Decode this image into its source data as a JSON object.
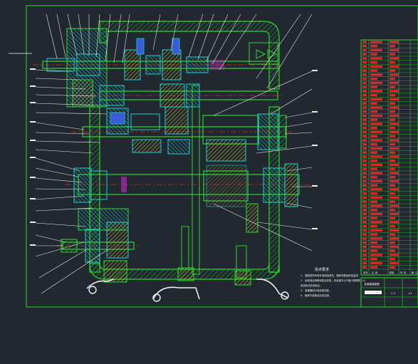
{
  "drawing": {
    "background": "#212830",
    "frame_color": "#2fd62f",
    "tech_notes": {
      "title": "技术要求",
      "lines": [
        "1. 装配前所有零件用煤油清洗，箱体内壁涂耐油油漆。",
        "2. 齿轮啮合侧隙用铅丝检验，其余量不小于最小侧隙的1/4，",
        "   用涂色法检验斑点。",
        "3. 减速器剖分面涂密封胶。",
        "4. 箱体外表面涂灰色油漆。"
      ]
    },
    "parts_table": {
      "header": [
        "序号",
        "名 称",
        "数量",
        "材 料",
        "备 注"
      ],
      "row_count": 56
    },
    "title_block": {
      "name": "变速箱装配图",
      "scale": "1:2",
      "sheet": "A1"
    },
    "colors": {
      "outline": "#2fd62f",
      "section": "#1ad1d1",
      "hatch": "#d6d22a",
      "centerline": "#d62a2a",
      "leader": "#f0f0f0",
      "magenta": "#d62ad6",
      "blue": "#3a5ad6"
    }
  }
}
